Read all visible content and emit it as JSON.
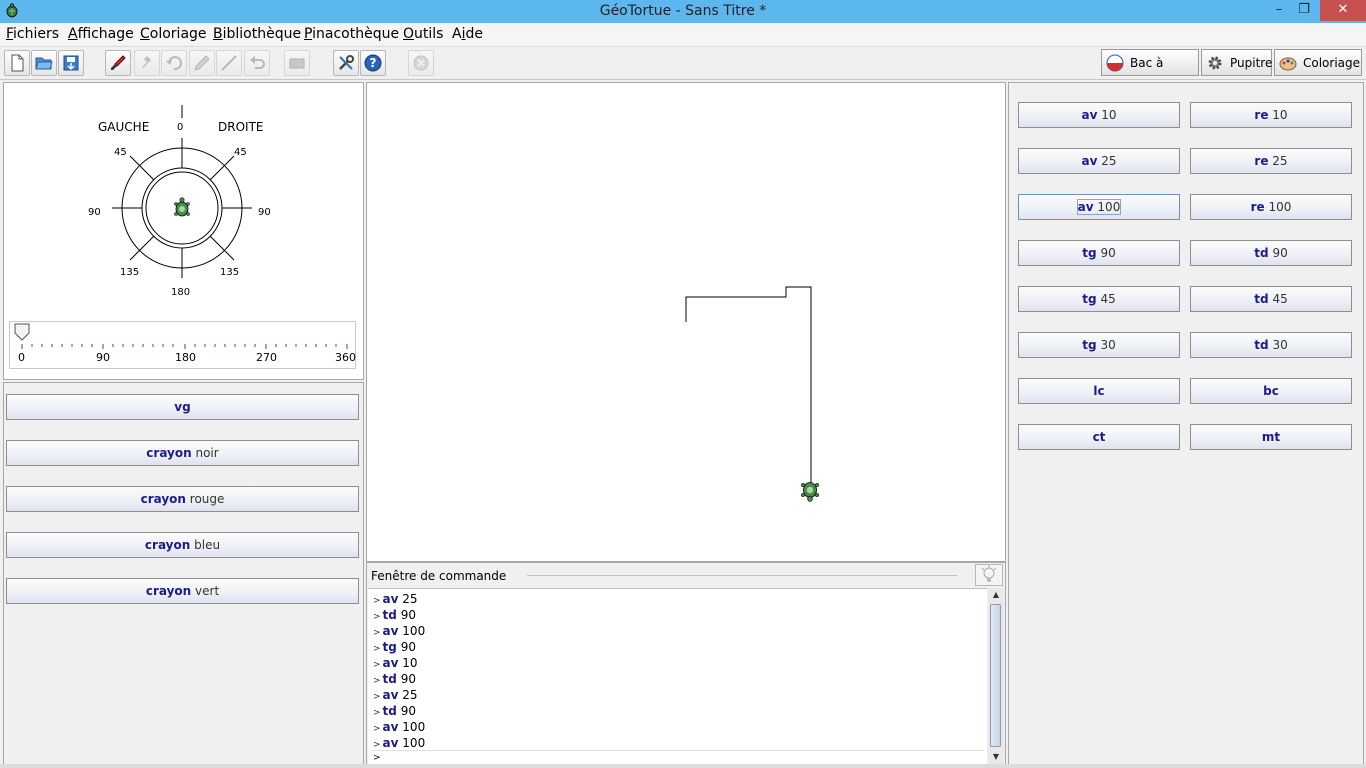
{
  "window": {
    "title": "GéoTortue - Sans Titre *"
  },
  "menu": [
    {
      "label": "Fichiers",
      "mnemonic": "F",
      "rest": "ichiers"
    },
    {
      "label": "Affichage",
      "mnemonic": "A",
      "rest": "ffichage"
    },
    {
      "label": "Coloriage",
      "mnemonic": "C",
      "rest": "oloriage"
    },
    {
      "label": "Bibliothèque",
      "mnemonic": "B",
      "rest": "ibliothèque"
    },
    {
      "label": "Pinacothèque",
      "mnemonic": "P",
      "rest": "inacothèque"
    },
    {
      "label": "Outils",
      "mnemonic": "O",
      "rest": "utils"
    },
    {
      "label": "Aide",
      "pre": "A",
      "mnemonic": "i",
      "rest": "de"
    }
  ],
  "toolbar": {
    "icons": [
      "new-file-icon",
      "open-folder-icon",
      "save-icon",
      "brush-icon",
      "pin-icon",
      "undo-turn-icon",
      "pencil-icon",
      "line-icon",
      "undo-icon",
      "eraser-icon",
      "tools-icon",
      "help-icon",
      "stop-icon"
    ],
    "modes": [
      {
        "label": "Bac à sable",
        "icon": "sandbox-icon"
      },
      {
        "label": "Pupitre",
        "icon": "gear-icon"
      },
      {
        "label": "Coloriage",
        "icon": "palette-icon"
      }
    ]
  },
  "compass": {
    "gauche": "GAUCHE",
    "droite": "DROITE",
    "labels": {
      "top": "0",
      "nw": "45",
      "ne": "45",
      "w": "90",
      "e": "90",
      "sw": "135",
      "se": "135",
      "bottom": "180"
    }
  },
  "slider": {
    "ticks": [
      "0",
      "90",
      "180",
      "270",
      "360"
    ],
    "value": 0
  },
  "left_buttons": [
    {
      "kw": "vg",
      "arg": ""
    },
    {
      "kw": "crayon",
      "arg": "noir"
    },
    {
      "kw": "crayon",
      "arg": "rouge"
    },
    {
      "kw": "crayon",
      "arg": "bleu"
    },
    {
      "kw": "crayon",
      "arg": "vert"
    }
  ],
  "right_buttons": [
    {
      "kw": "av",
      "arg": "10"
    },
    {
      "kw": "re",
      "arg": "10"
    },
    {
      "kw": "av",
      "arg": "25"
    },
    {
      "kw": "re",
      "arg": "25"
    },
    {
      "kw": "av",
      "arg": "100"
    },
    {
      "kw": "re",
      "arg": "100"
    },
    {
      "kw": "tg",
      "arg": "90"
    },
    {
      "kw": "td",
      "arg": "90"
    },
    {
      "kw": "tg",
      "arg": "45"
    },
    {
      "kw": "td",
      "arg": "45"
    },
    {
      "kw": "tg",
      "arg": "30"
    },
    {
      "kw": "td",
      "arg": "30"
    },
    {
      "kw": "lc",
      "arg": ""
    },
    {
      "kw": "bc",
      "arg": ""
    },
    {
      "kw": "ct",
      "arg": ""
    },
    {
      "kw": "mt",
      "arg": ""
    }
  ],
  "command_window": {
    "title": "Fenêtre de commande",
    "prompt": ">",
    "history": [
      {
        "kw": "av",
        "arg": "25"
      },
      {
        "kw": "td",
        "arg": "90"
      },
      {
        "kw": "av",
        "arg": "100"
      },
      {
        "kw": "tg",
        "arg": "90"
      },
      {
        "kw": "av",
        "arg": "10"
      },
      {
        "kw": "td",
        "arg": "90"
      },
      {
        "kw": "av",
        "arg": "25"
      },
      {
        "kw": "td",
        "arg": "90"
      },
      {
        "kw": "av",
        "arg": "100"
      },
      {
        "kw": "av",
        "arg": "100"
      }
    ],
    "input": ""
  },
  "colors": {
    "keyword": "#1c1c8c",
    "titlebar": "#5cb7ee",
    "close": "#c75050"
  }
}
